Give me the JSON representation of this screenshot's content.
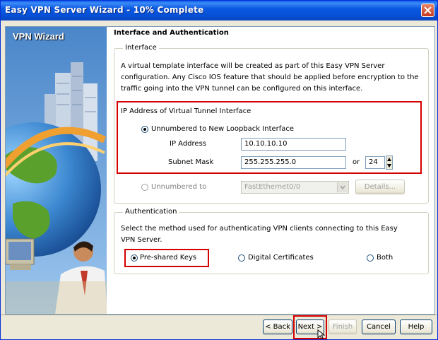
{
  "window": {
    "title": "Easy VPN Server Wizard - 10% Complete"
  },
  "sidebar": {
    "title": "VPN Wizard"
  },
  "page": {
    "section_title": "Interface and Authentication",
    "interface_group": {
      "legend": "Interface",
      "description": "A virtual template interface will be created as part of this Easy VPN Server configuration. Any Cisco IOS feature that should be applied before encryption to the traffic going into the VPN tunnel can be configured on this interface.",
      "ip_section_title": "IP Address of Virtual Tunnel Interface",
      "unnumbered_loopback_label": "Unnumbered to New Loopback Interface",
      "ip_address_label": "IP Address",
      "ip_address_value": "10.10.10.10",
      "subnet_mask_label": "Subnet Mask",
      "subnet_mask_value": "255.255.255.0",
      "or_label": "or",
      "prefix_value": "24",
      "unnumbered_to_label": "Unnumbered to",
      "interface_select_value": "FastEthernet0/0",
      "details_button": "Details..."
    },
    "auth_group": {
      "legend": "Authentication",
      "description": "Select the method used for authenticating VPN clients connecting to this Easy VPN Server.",
      "preshared_label": "Pre-shared Keys",
      "digital_cert_label": "Digital Certificates",
      "both_label": "Both"
    }
  },
  "footer": {
    "back_label": "< Back",
    "next_label": "Next >",
    "finish_label": "Finish",
    "cancel_label": "Cancel",
    "help_label": "Help"
  },
  "colors": {
    "title_bar": "#0a58e2",
    "highlight_red": "#d40000"
  }
}
